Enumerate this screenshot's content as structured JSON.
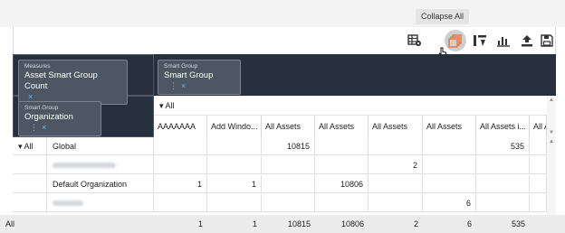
{
  "tooltip": "Collapse All",
  "toolbar": {
    "buttons": [
      {
        "name": "table-settings-icon"
      },
      {
        "name": "collapse-all-icon"
      },
      {
        "name": "column-toggle-icon"
      },
      {
        "name": "bar-chart-icon"
      },
      {
        "name": "export-icon"
      },
      {
        "name": "save-icon"
      }
    ]
  },
  "pills": {
    "measures": {
      "caption": "Measures",
      "value": "Asset Smart Group Count"
    },
    "columns": {
      "caption": "Smart Group",
      "value": "Smart Group"
    },
    "rows": {
      "caption": "Smart Group",
      "value": "Organization"
    }
  },
  "icons": {
    "remove": "×",
    "more": "⋮",
    "expand_down": "▾"
  },
  "column_group_label": "All",
  "row_group_label": "All",
  "columns": [
    "AAAAAAA",
    "Add Windo...",
    "All Assets",
    "All Assets",
    "All Assets",
    "All Assets",
    "All Assets i...",
    "All A"
  ],
  "rows": [
    {
      "label": "Global",
      "blurred": false,
      "values": [
        "",
        "",
        "10815",
        "",
        "",
        "",
        "535",
        ""
      ]
    },
    {
      "label": "",
      "blurred": true,
      "values": [
        "",
        "",
        "",
        "",
        "2",
        "",
        "",
        ""
      ]
    },
    {
      "label": "Default Organization",
      "blurred": false,
      "values": [
        "1",
        "1",
        "",
        "10806",
        "",
        "",
        "",
        ""
      ]
    },
    {
      "label": "",
      "blurred": true,
      "values": [
        "",
        "",
        "",
        "",
        "",
        "6",
        "",
        ""
      ]
    }
  ],
  "totals": {
    "label": "All",
    "values": [
      "1",
      "1",
      "10815",
      "10806",
      "2",
      "6",
      "535",
      ""
    ]
  }
}
